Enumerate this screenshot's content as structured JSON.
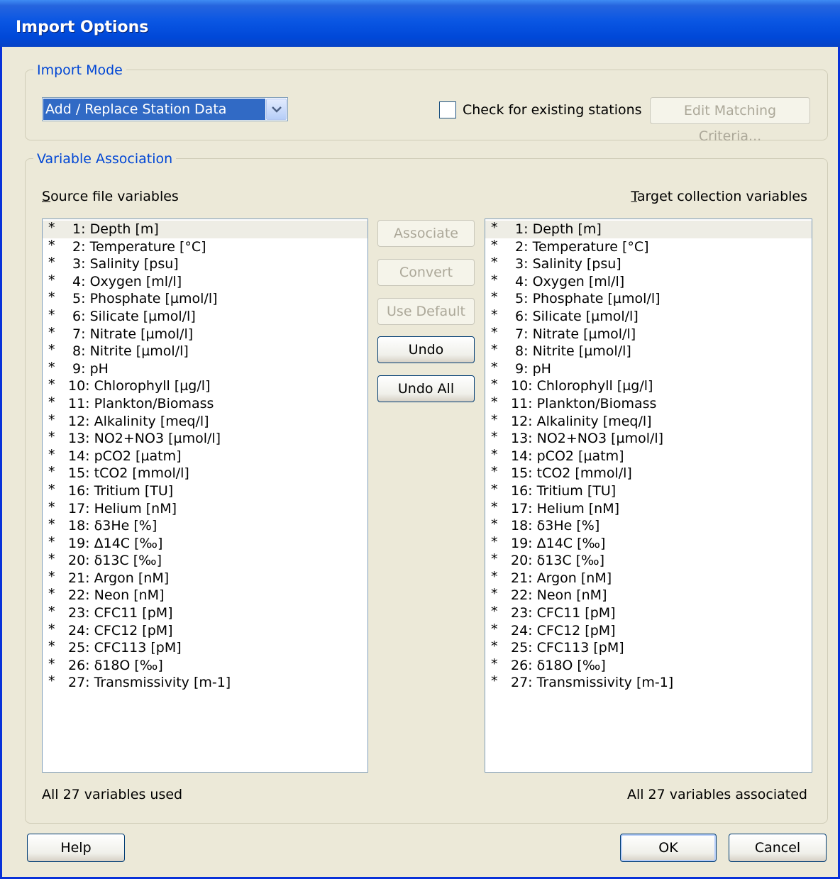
{
  "window": {
    "title": "Import Options"
  },
  "import_mode": {
    "group_label": "Import Mode",
    "mode_select_value": "Add / Replace Station Data",
    "check_existing_label": "Check for existing stations",
    "check_existing_checked": false,
    "edit_matching_label": "Edit Matching Criteria..."
  },
  "variable_association": {
    "group_label": "Variable Association",
    "source_header": "Source file variables",
    "target_header": "Target collection variables",
    "buttons": {
      "associate": "Associate",
      "convert": "Convert",
      "use_default": "Use Default",
      "undo": "Undo",
      "undo_all": "Undo All"
    },
    "source_status": "All 27 variables used",
    "target_status": "All 27 variables associated",
    "marker": "*",
    "variables": [
      " 1: Depth [m]",
      " 2: Temperature [°C]",
      " 3: Salinity [psu]",
      " 4: Oxygen [ml/l]",
      " 5: Phosphate [µmol/l]",
      " 6: Silicate [µmol/l]",
      " 7: Nitrate [µmol/l]",
      " 8: Nitrite [µmol/l]",
      " 9: pH",
      "10: Chlorophyll [µg/l]",
      "11: Plankton/Biomass",
      "12: Alkalinity [meq/l]",
      "13: NO2+NO3 [µmol/l]",
      "14: pCO2 [µatm]",
      "15: tCO2 [mmol/l]",
      "16: Tritium [TU]",
      "17: Helium [nM]",
      "18: δ3He [%]",
      "19: Δ14C [‰]",
      "20: δ13C [‰]",
      "21: Argon [nM]",
      "22: Neon [nM]",
      "23: CFC11 [pM]",
      "24: CFC12 [pM]",
      "25: CFC113 [pM]",
      "26: δ18O [‰]",
      "27: Transmissivity [m-1]"
    ]
  },
  "footer": {
    "help": "Help",
    "ok": "OK",
    "cancel": "Cancel"
  }
}
